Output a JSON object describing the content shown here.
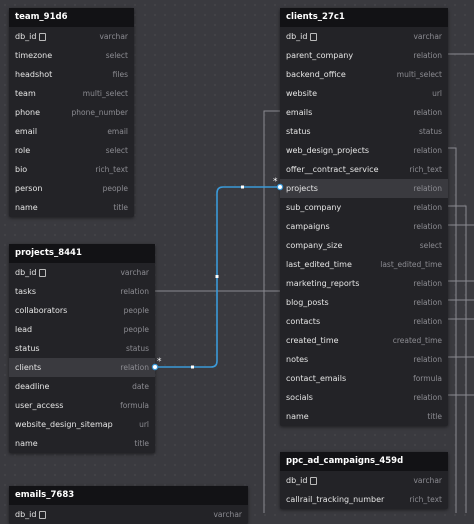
{
  "tables": {
    "team": {
      "title": "team_91d6",
      "fields": [
        {
          "name": "db_id",
          "type": "varchar",
          "key": true
        },
        {
          "name": "timezone",
          "type": "select"
        },
        {
          "name": "headshot",
          "type": "files"
        },
        {
          "name": "team",
          "type": "multi_select"
        },
        {
          "name": "phone",
          "type": "phone_number"
        },
        {
          "name": "email",
          "type": "email"
        },
        {
          "name": "role",
          "type": "select"
        },
        {
          "name": "bio",
          "type": "rich_text"
        },
        {
          "name": "person",
          "type": "people"
        },
        {
          "name": "name",
          "type": "title"
        }
      ]
    },
    "clients": {
      "title": "clients_27c1",
      "fields": [
        {
          "name": "db_id",
          "type": "varchar",
          "key": true
        },
        {
          "name": "parent_company",
          "type": "relation"
        },
        {
          "name": "backend_office",
          "type": "multi_select"
        },
        {
          "name": "website",
          "type": "url"
        },
        {
          "name": "emails",
          "type": "relation"
        },
        {
          "name": "status",
          "type": "status"
        },
        {
          "name": "web_design_projects",
          "type": "relation"
        },
        {
          "name": "offer__contract_service",
          "type": "rich_text"
        },
        {
          "name": "projects",
          "type": "relation"
        },
        {
          "name": "sub_company",
          "type": "relation"
        },
        {
          "name": "campaigns",
          "type": "relation"
        },
        {
          "name": "company_size",
          "type": "select"
        },
        {
          "name": "last_edited_time",
          "type": "last_edited_time"
        },
        {
          "name": "marketing_reports",
          "type": "relation"
        },
        {
          "name": "blog_posts",
          "type": "relation"
        },
        {
          "name": "contacts",
          "type": "relation"
        },
        {
          "name": "created_time",
          "type": "created_time"
        },
        {
          "name": "notes",
          "type": "relation"
        },
        {
          "name": "contact_emails",
          "type": "formula"
        },
        {
          "name": "socials",
          "type": "relation"
        },
        {
          "name": "name",
          "type": "title"
        }
      ]
    },
    "projects": {
      "title": "projects_8441",
      "fields": [
        {
          "name": "db_id",
          "type": "varchar",
          "key": true
        },
        {
          "name": "tasks",
          "type": "relation"
        },
        {
          "name": "collaborators",
          "type": "people"
        },
        {
          "name": "lead",
          "type": "people"
        },
        {
          "name": "status",
          "type": "status"
        },
        {
          "name": "clients",
          "type": "relation"
        },
        {
          "name": "deadline",
          "type": "date"
        },
        {
          "name": "user_access",
          "type": "formula"
        },
        {
          "name": "website_design_sitemap",
          "type": "url"
        },
        {
          "name": "name",
          "type": "title"
        }
      ]
    },
    "ppc": {
      "title": "ppc_ad_campaigns_459d",
      "fields": [
        {
          "name": "db_id",
          "type": "varchar",
          "key": true
        },
        {
          "name": "callrail_tracking_number",
          "type": "rich_text"
        }
      ]
    },
    "emails": {
      "title": "emails_7683",
      "fields": [
        {
          "name": "db_id",
          "type": "varchar",
          "key": true
        }
      ]
    }
  },
  "relationship_marker": "*",
  "colors": {
    "canvas": "#3a3a3f",
    "table_body": "#232327",
    "table_header": "#121215",
    "highlight_link": "#3b9ad9",
    "dim_link": "#8a8a90"
  }
}
